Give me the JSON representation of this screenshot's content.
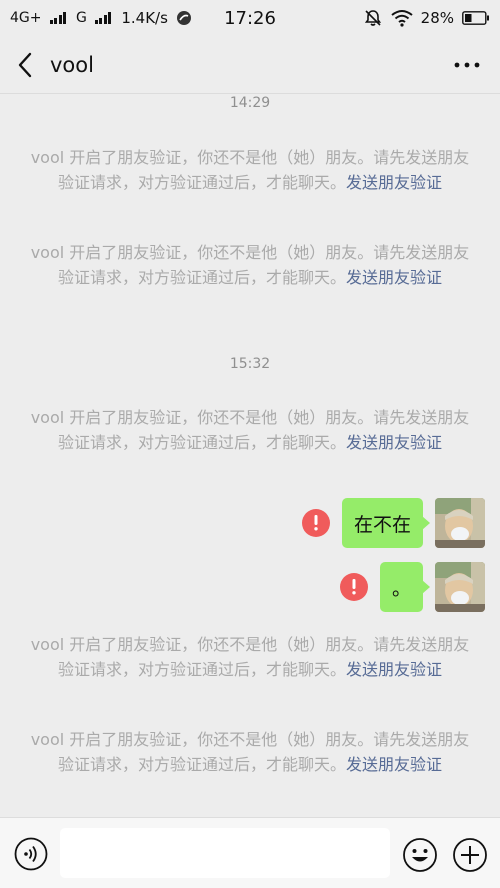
{
  "status_bar": {
    "network1": "4G+",
    "network2": "G",
    "speed": "1.4K/s",
    "time": "17:26",
    "battery": "28%"
  },
  "nav": {
    "title": "vool"
  },
  "chat": {
    "time1": "14:29",
    "time2": "15:32",
    "system_text": "vool 开启了朋友验证，你还不是他（她）朋友。请先发送朋友验证请求，对方验证通过后，才能聊天。",
    "system_link": "发送朋友验证",
    "messages": [
      {
        "text": "在不在",
        "status": "failed"
      },
      {
        "text": "。",
        "status": "failed"
      }
    ]
  },
  "input": {
    "placeholder": ""
  },
  "colors": {
    "bubble": "#95ec69",
    "error": "#f05b5b",
    "link": "#576b95",
    "background": "#ededed"
  }
}
